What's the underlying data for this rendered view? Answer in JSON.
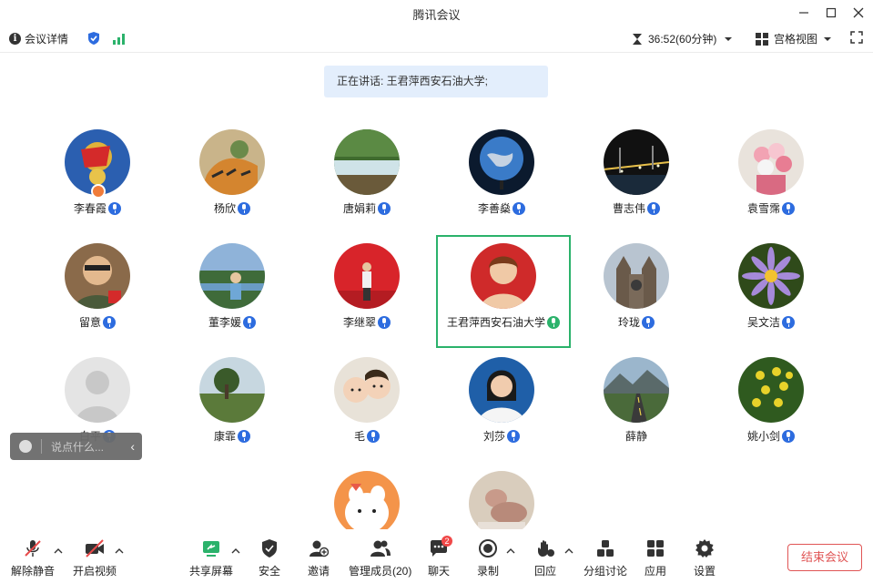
{
  "window": {
    "title": "腾讯会议"
  },
  "infobar": {
    "details_label": "会议详情",
    "timer": "36:52(60分钟)",
    "view_label": "宫格视图"
  },
  "speaker": {
    "text": "正在讲话: 王君萍西安石油大学;"
  },
  "participants": [
    {
      "name": "李春霞"
    },
    {
      "name": "杨欣"
    },
    {
      "name": "唐娟莉"
    },
    {
      "name": "李善燊"
    },
    {
      "name": "曹志伟"
    },
    {
      "name": "袁雪霈"
    },
    {
      "name": "留意"
    },
    {
      "name": "董李媛"
    },
    {
      "name": "李继翠"
    },
    {
      "name": "王君萍西安石油大学"
    },
    {
      "name": "玲珑"
    },
    {
      "name": "吴文洁"
    },
    {
      "name": "白平"
    },
    {
      "name": "康霏"
    },
    {
      "name": "毛"
    },
    {
      "name": "刘莎"
    },
    {
      "name": "薛静"
    },
    {
      "name": "姚小剑"
    },
    {
      "name": ""
    },
    {
      "name": ""
    }
  ],
  "chat": {
    "placeholder": "说点什么..."
  },
  "toolbar": {
    "unmute": "解除静音",
    "start_video": "开启视频",
    "share_screen": "共享屏幕",
    "security": "安全",
    "invite": "邀请",
    "members": "管理成员(20)",
    "chat": "聊天",
    "chat_badge": "2",
    "record": "录制",
    "reactions": "回应",
    "breakout": "分组讨论",
    "apps": "应用",
    "settings": "设置",
    "end": "结束会议"
  },
  "colors": {
    "accent": "#2d6cdf",
    "active_border": "#2bb26b",
    "end_button": "#e05555",
    "speaker_bg": "#e3eefc"
  }
}
